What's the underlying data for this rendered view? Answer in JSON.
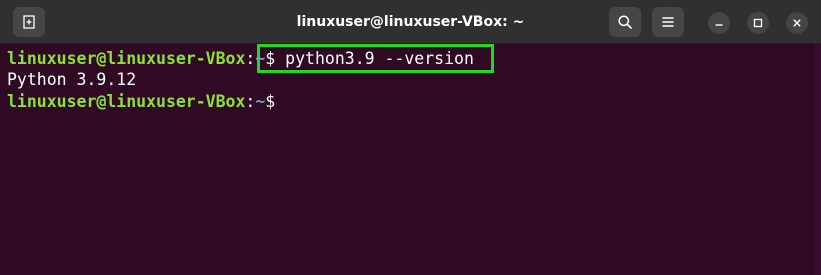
{
  "window": {
    "title": "linuxuser@linuxuser-VBox: ~"
  },
  "toolbar": {
    "new_tab_icon": "new-tab-icon",
    "search_icon": "search-icon",
    "menu_icon": "hamburger-menu-icon",
    "minimize_icon": "minimize-icon",
    "maximize_icon": "maximize-icon",
    "close_icon": "close-icon"
  },
  "terminal": {
    "lines": [
      {
        "user_host": "linuxuser@linuxuser-VBox",
        "colon": ":",
        "path": "~",
        "prompt_symbol": "$",
        "command": " python3.9 --version"
      },
      {
        "output": "Python 3.9.12"
      },
      {
        "user_host": "linuxuser@linuxuser-VBox",
        "colon": ":",
        "path": "~",
        "prompt_symbol": "$",
        "command": ""
      }
    ]
  },
  "colors": {
    "terminal_bg": "#300a24",
    "titlebar_bg": "#303030",
    "prompt_user": "#8ae234",
    "prompt_path": "#729fcf",
    "highlight_border": "#1fdb1f"
  }
}
